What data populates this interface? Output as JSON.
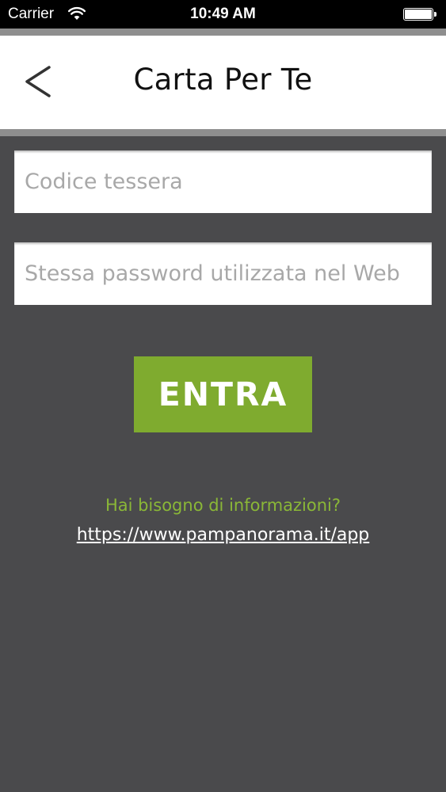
{
  "status_bar": {
    "carrier": "Carrier",
    "time": "10:49 AM",
    "battery_level": 100
  },
  "nav": {
    "title": "Carta Per Te",
    "back_icon": "chevron-left-icon"
  },
  "form": {
    "code_placeholder": "Codice tessera",
    "code_value": "",
    "password_placeholder": "Stessa password utilizzata nel Web",
    "password_value": "",
    "submit_label": "ENTRA"
  },
  "info": {
    "question": "Hai bisogno di informazioni?",
    "link": "https://www.pampanorama.it/app"
  },
  "colors": {
    "background": "#4a4a4c",
    "accent_green": "#7fab2f",
    "info_green": "#8ab737",
    "nav_background": "#ffffff"
  }
}
